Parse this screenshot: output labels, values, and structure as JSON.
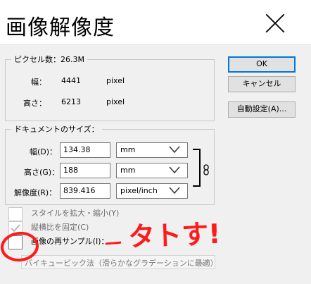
{
  "dialog": {
    "title": "画像解像度"
  },
  "pixel_info": {
    "legend": "ピクセル数：26.3M",
    "width_label": "幅：",
    "width_value": "4441",
    "width_unit": "pixel",
    "height_label": "高さ：",
    "height_value": "6213",
    "height_unit": "pixel"
  },
  "document_size": {
    "legend": "ドキュメントのサイズ：",
    "width_label": "幅(D)：",
    "width_value": "134.38",
    "width_unit": "mm",
    "height_label": "高さ(G)：",
    "height_value": "188",
    "height_unit": "mm",
    "resolution_label": "解像度(R)：",
    "resolution_value": "839.416",
    "resolution_unit": "pixel/inch"
  },
  "buttons": {
    "ok": "OK",
    "cancel": "キャンセル",
    "auto": "自動設定(A)..."
  },
  "options": {
    "scale_styles": "スタイルを拡大・縮小(Y)",
    "constrain": "縦横比を固定(C)",
    "resample": "画像の再サンプル(I)：",
    "resample_method": "バイキュービック法（滑らかなグラデーションに最適）"
  },
  "annotation": {
    "text": "タトす!",
    "color": "#ff1a1a"
  },
  "colors": {
    "accent": "#0078d7",
    "annotation_red": "#ff1a1a"
  }
}
